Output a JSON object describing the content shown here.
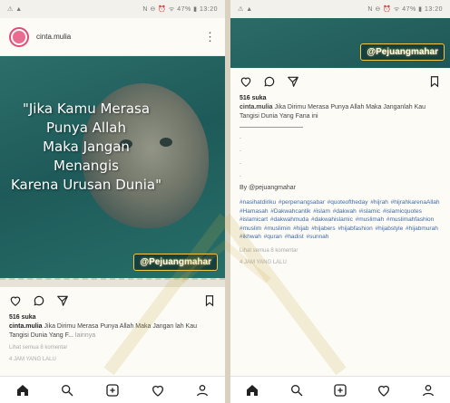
{
  "status_bar": {
    "left_icons": "⚠ ▲",
    "right_text": "N ⊖ ⏰ ᯤ 47% ▮ 13:20"
  },
  "colors": {
    "accent": "#e04b7c",
    "photo_bg": "#1e5a59",
    "tag_bg": "#173f3d",
    "hashtag": "#3d6aa8"
  },
  "left": {
    "username": "cinta.mulia",
    "quote": "\"Jika Kamu Merasa\nPunya Allah\nMaka Jangan\nMenangis\nKarena Urusan Dunia\"",
    "watermark": "@Pejuangmahar",
    "likes": "516 suka",
    "caption_user": "cinta.mulia",
    "caption_text": " Jika Dirimu Merasa Punya Allah Maka Jangan lah Kau Tangisi Dunia Yang F...",
    "caption_more": "lainnya",
    "comments": "Lihat semua 8 komentar",
    "time": "4 JAM YANG LALU"
  },
  "right": {
    "watermark": "@Pejuangmahar",
    "likes": "516 suka",
    "caption_user": "cinta.mulia",
    "caption_text": " Jika Dirimu Merasa Punya Allah Maka Janganlah Kau Tangisi Dunia Yang Fana ini",
    "dots": ".\n.\n.\n.",
    "credit": "By @pejuangmahar",
    "hashtags": "#nasihatdiriku #perpenangsabar #quoteoftheday #hijrah #hijrahkarenaAllah #Hamasah #Dakwahcantik #islam #dakwah #islamic #islamicquotes #islamicart #dakwahmuda #dakwahislamic #muslimah #muslimahfashion #muslim #muslimin #hijab #hijabers #hijabfashion #hijabstyle #hijabmurah #ikhwah #quran #hadist #sunnah",
    "comments": "Lihat semua 8 komentar",
    "time": "4 JAM YANG LALU"
  },
  "nav_icons": [
    "home-icon",
    "search-icon",
    "add-post-icon",
    "heart-icon",
    "profile-icon"
  ]
}
